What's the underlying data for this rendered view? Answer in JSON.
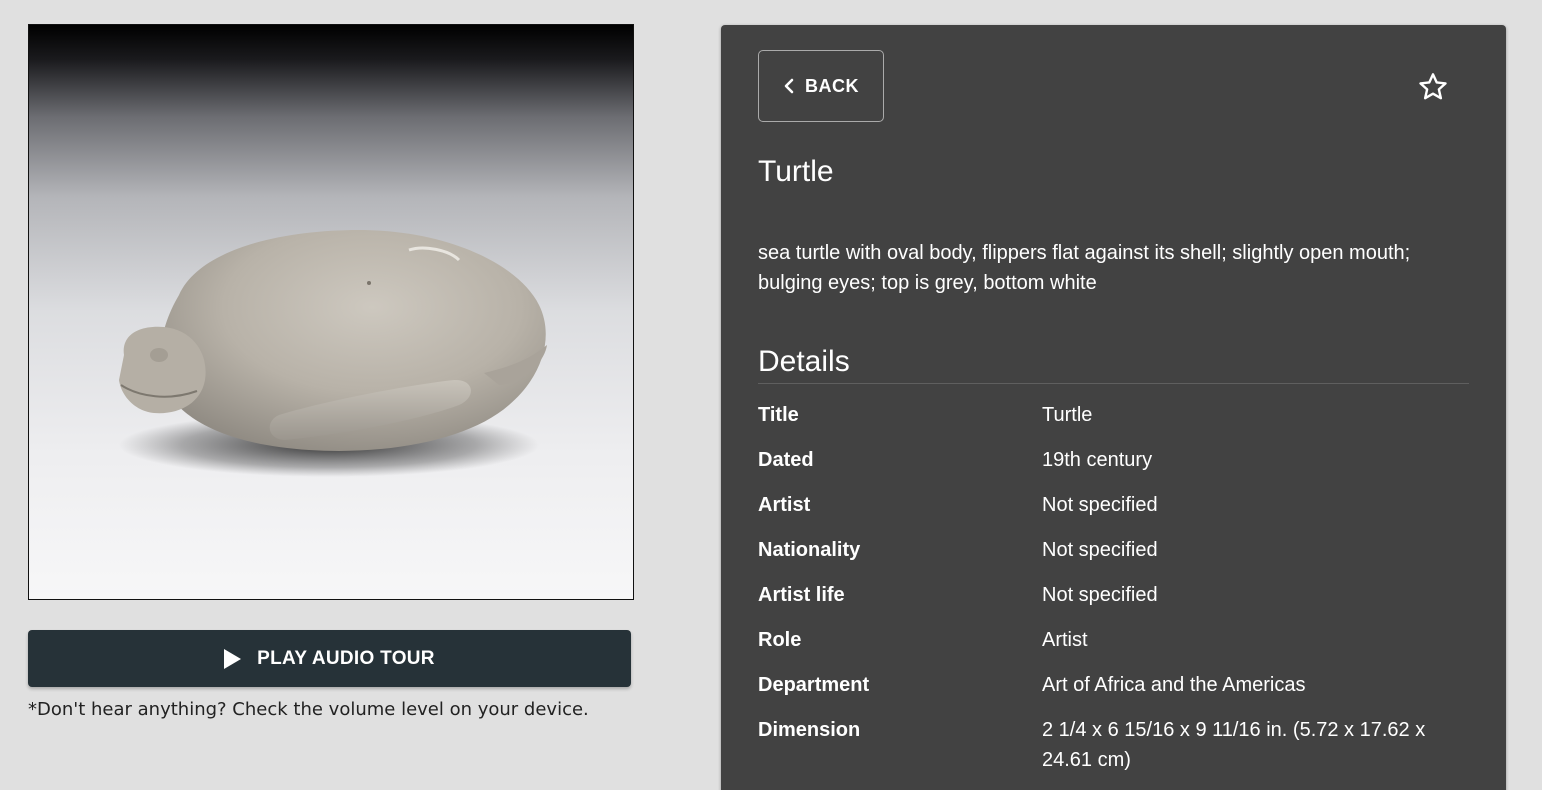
{
  "audio": {
    "button_label": "PLAY AUDIO TOUR",
    "hint": "*Don't hear anything? Check the volume level on your device."
  },
  "panel": {
    "back_label": "BACK",
    "title": "Turtle",
    "description": "sea turtle with oval body, flippers flat against its shell; slightly open mouth; bulging eyes; top is grey, bottom white",
    "details_heading": "Details",
    "details": [
      {
        "label": "Title",
        "value": "Turtle"
      },
      {
        "label": "Dated",
        "value": "19th century"
      },
      {
        "label": "Artist",
        "value": "Not specified"
      },
      {
        "label": "Nationality",
        "value": "Not specified"
      },
      {
        "label": "Artist life",
        "value": "Not specified"
      },
      {
        "label": "Role",
        "value": "Artist"
      },
      {
        "label": "Department",
        "value": "Art of Africa and the Americas"
      },
      {
        "label": "Dimension",
        "value": "2 1/4 x 6 15/16 x 9 11/16 in. (5.72 x 17.62 x 24.61 cm)"
      }
    ]
  },
  "icons": {
    "back": "chevron-left-icon",
    "favorite": "star-outline-icon",
    "play": "play-icon"
  }
}
